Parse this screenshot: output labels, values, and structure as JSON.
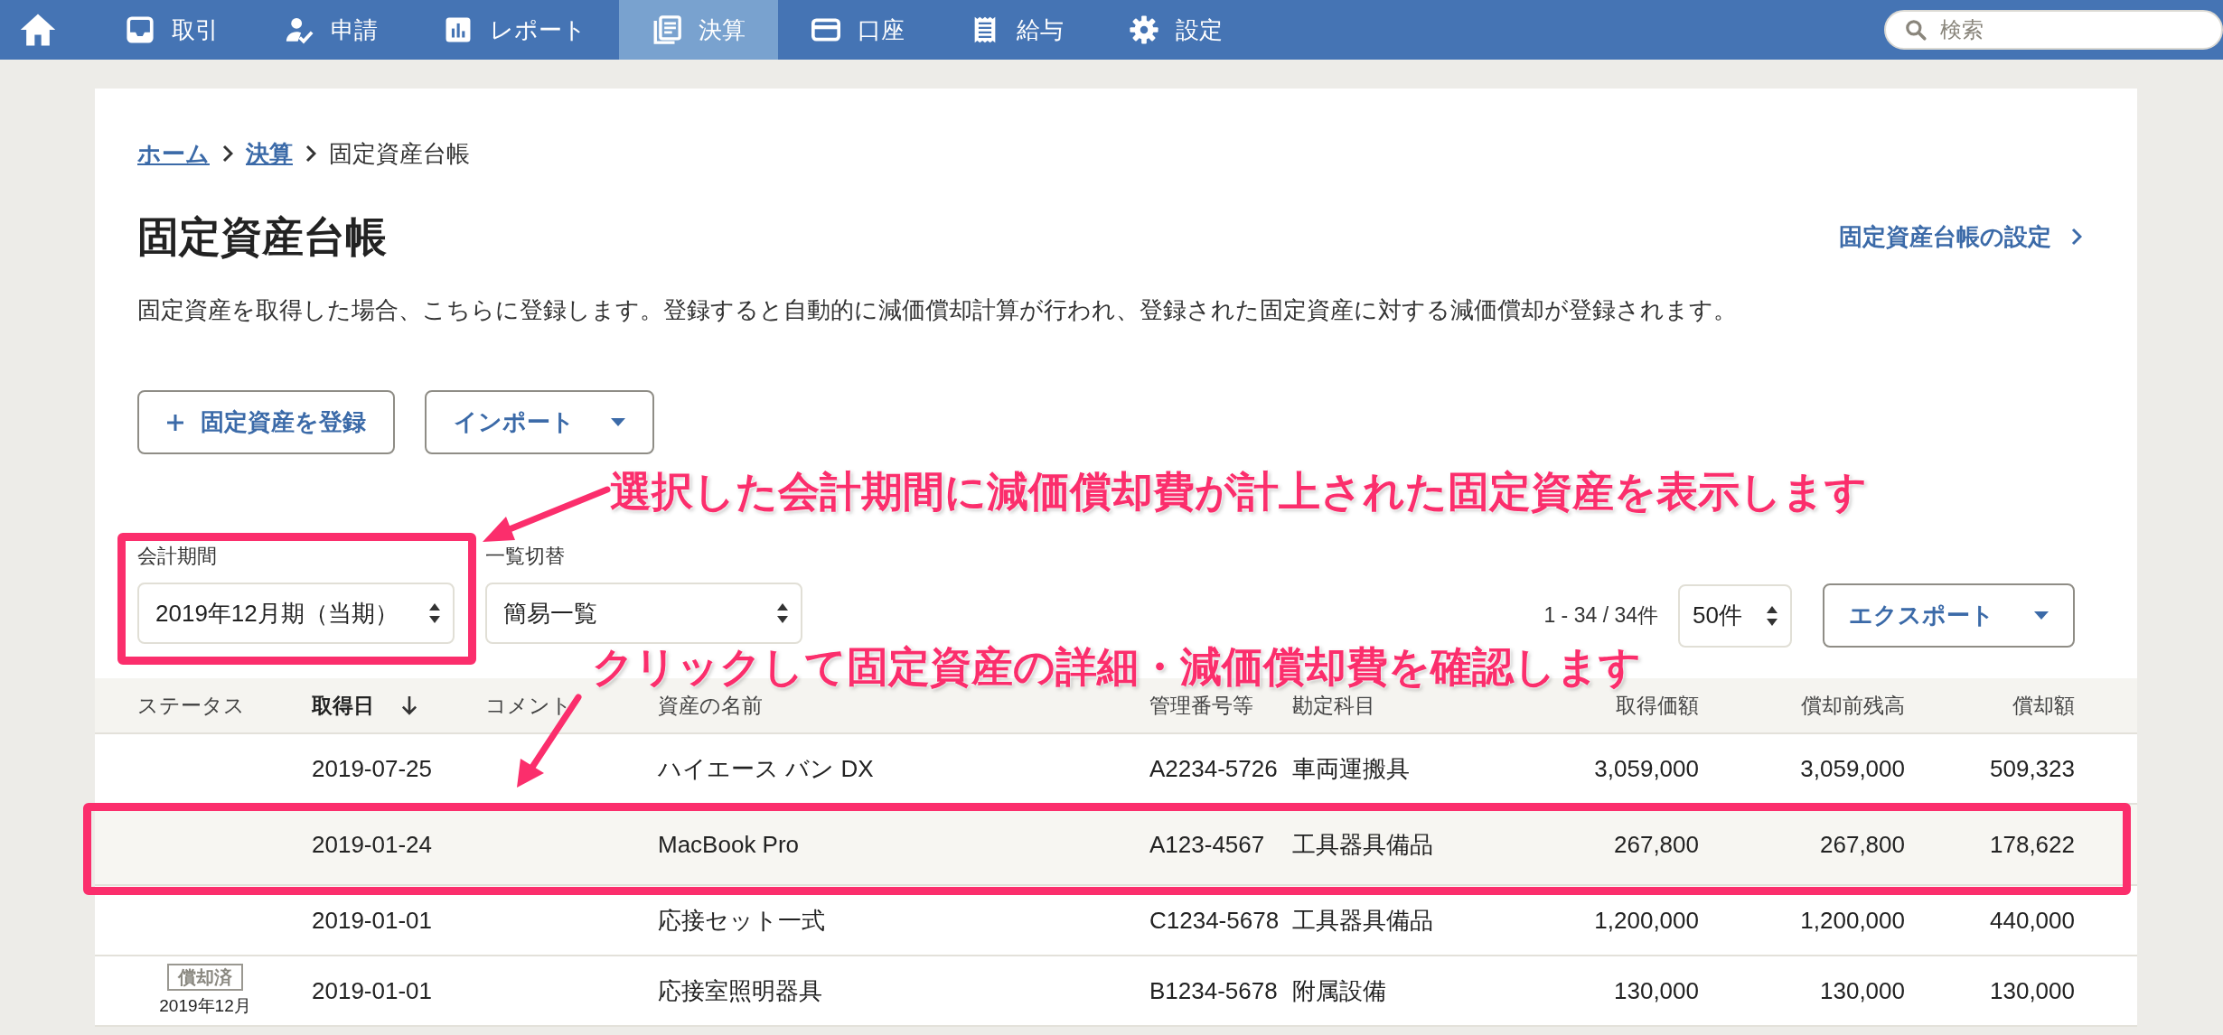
{
  "nav": {
    "items": [
      {
        "kind": "icon",
        "selected": false
      },
      {
        "kind": "tab",
        "label": "取引",
        "selected": false
      },
      {
        "kind": "tab",
        "label": "申請",
        "selected": false
      },
      {
        "kind": "tab",
        "label": "レポート",
        "selected": false
      },
      {
        "kind": "tab",
        "label": "決算",
        "selected": true
      },
      {
        "kind": "tab",
        "label": "口座",
        "selected": false
      },
      {
        "kind": "tab",
        "label": "給与",
        "selected": false
      },
      {
        "kind": "tab",
        "label": "設定",
        "selected": false
      }
    ],
    "search": {
      "placeholder": "検索"
    }
  },
  "breadcrumb": [
    {
      "label": "ホーム",
      "link": true
    },
    {
      "label": "決算",
      "link": true
    },
    {
      "label": "固定資産台帳",
      "link": false
    }
  ],
  "title": "固定資産台帳",
  "settings_link": "固定資産台帳の設定",
  "description": "固定資産を取得した場合、こちらに登録します。登録すると自動的に減価償却計算が行われ、登録された固定資産に対する減価償却が登録されます。",
  "actions": [
    {
      "kind": "add",
      "label": "固定資産を登録"
    },
    {
      "kind": "dropdown",
      "label": "インポート"
    }
  ],
  "filters": [
    {
      "label": "会計期間",
      "value": "2019年12月期（当期）"
    },
    {
      "label": "一覧切替",
      "value": "簡易一覧"
    }
  ],
  "pagination": {
    "range": "1 - 34 / 34件",
    "per_page": "50件"
  },
  "export": "エクスポート",
  "table": {
    "columns": [
      {
        "label": "ステータス",
        "sorted": false
      },
      {
        "label": "取得日",
        "sorted": true
      },
      {
        "label": "コメント",
        "sorted": false
      },
      {
        "label": "資産の名前",
        "sorted": false
      },
      {
        "label": "管理番号等",
        "sorted": false
      },
      {
        "label": "勘定科目",
        "sorted": false
      },
      {
        "label": "取得価額",
        "sorted": false
      },
      {
        "label": "償却前残高",
        "sorted": false
      },
      {
        "label": "償却額",
        "sorted": false
      }
    ],
    "rows": [
      {
        "selected": false,
        "date": "2019-07-25",
        "name": "ハイエース バン DX",
        "code": "A2234-5726",
        "account": "車両運搬具",
        "cost": "3,059,000",
        "book_value": "3,059,000",
        "depreciation": "509,323"
      },
      {
        "selected": true,
        "date": "2019-01-24",
        "name": "MacBook Pro",
        "code": "A123-4567",
        "account": "工具器具備品",
        "cost": "267,800",
        "book_value": "267,800",
        "depreciation": "178,622"
      },
      {
        "selected": false,
        "date": "2019-01-01",
        "name": "応接セット一式",
        "code": "C1234-5678",
        "account": "工具器具備品",
        "cost": "1,200,000",
        "book_value": "1,200,000",
        "depreciation": "440,000"
      },
      {
        "selected": false,
        "status": {
          "badge": "償却済",
          "date": "2019年12月"
        },
        "date": "2019-01-01",
        "name": "応接室照明器具",
        "code": "B1234-5678",
        "account": "附属設備",
        "cost": "130,000",
        "book_value": "130,000",
        "depreciation": "130,000"
      }
    ]
  },
  "annotations": [
    {
      "text": "選択した会計期間に減価償却費が計上された固定資産を表示します"
    },
    {
      "text": "クリックして固定資産の詳細・減価償却費を確認します"
    }
  ]
}
